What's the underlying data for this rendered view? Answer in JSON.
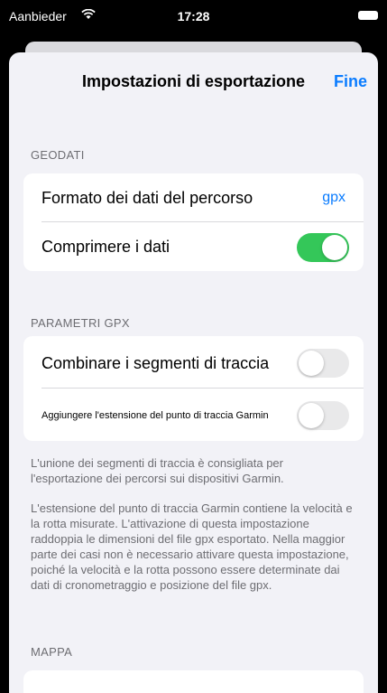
{
  "status_bar": {
    "carrier": "Aanbieder",
    "wifi_icon": "wifi-icon",
    "time": "17:28",
    "battery_icon": "battery-icon"
  },
  "nav": {
    "title": "Impostazioni di esportazione",
    "done_label": "Fine"
  },
  "sections": {
    "geodata": {
      "header": "GEODATI",
      "format_label": "Formato dei dati del percorso",
      "format_value": "gpx",
      "compress_label": "Comprimere i dati",
      "compress_on": true
    },
    "gpx": {
      "header": "PARAMETRI GPX",
      "combine_label": "Combinare i segmenti di traccia",
      "combine_on": false,
      "garmin_label": "Aggiungere l'estensione del punto di traccia Garmin",
      "garmin_on": false,
      "footer_1": "L'unione dei segmenti di traccia è consigliata per l'esportazione dei percorsi sui dispositivi Garmin.",
      "footer_2": "L'estensione del punto di traccia Garmin contiene la velocità e la rotta misurate. L'attivazione di questa impostazione raddoppia le dimensioni del file gpx esportato. Nella maggior parte dei casi non è necessario attivare questa impostazione, poiché la velocità e la rotta possono essere determinate dai dati di cronometraggio e posizione del file gpx."
    },
    "map": {
      "header": "MAPPA"
    }
  },
  "colors": {
    "accent": "#0a7cff",
    "toggle_on": "#34c759"
  }
}
